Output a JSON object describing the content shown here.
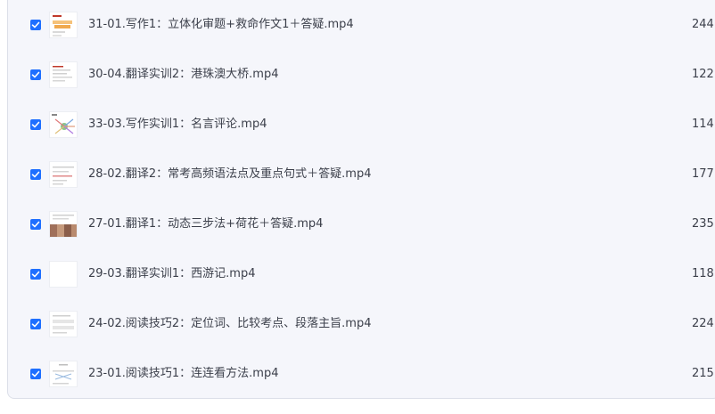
{
  "files": [
    {
      "name": "31-01.写作1：立体化审题+救命作文1＋答疑.mp4",
      "size": "244.",
      "checked": true,
      "thumb_icon": "video-thumbnail-icon"
    },
    {
      "name": "30-04.翻译实训2：港珠澳大桥.mp4",
      "size": "122.",
      "checked": true,
      "thumb_icon": "video-thumbnail-icon"
    },
    {
      "name": "33-03.写作实训1：名言评论.mp4",
      "size": "114l",
      "checked": true,
      "thumb_icon": "video-thumbnail-icon"
    },
    {
      "name": "28-02.翻译2：常考高频语法点及重点句式＋答疑.mp4",
      "size": "177.",
      "checked": true,
      "thumb_icon": "video-thumbnail-icon"
    },
    {
      "name": "27-01.翻译1：动态三步法+荷花＋答疑.mp4",
      "size": "235.",
      "checked": true,
      "thumb_icon": "video-thumbnail-icon"
    },
    {
      "name": "29-03.翻译实训1：西游记.mp4",
      "size": "118.",
      "checked": true,
      "thumb_icon": "video-thumbnail-icon"
    },
    {
      "name": "24-02.阅读技巧2：定位词、比较考点、段落主旨.mp4",
      "size": "224l",
      "checked": true,
      "thumb_icon": "video-thumbnail-icon"
    },
    {
      "name": "23-01.阅读技巧1：连连看方法.mp4",
      "size": "215.",
      "checked": true,
      "thumb_icon": "video-thumbnail-icon"
    }
  ],
  "colors": {
    "accent": "#1e6fff",
    "panel_bg": "#f5f6fb",
    "text": "#3b3f4a"
  }
}
